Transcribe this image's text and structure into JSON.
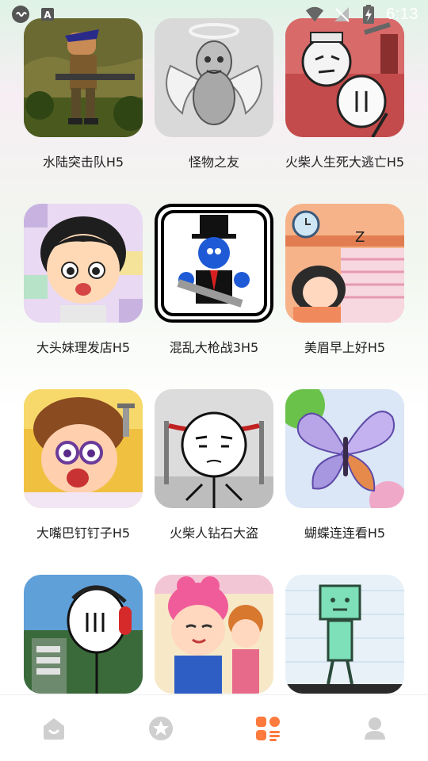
{
  "status_bar": {
    "time": "6:13",
    "icons": [
      "cast-icon",
      "a-notification-icon",
      "wifi-icon",
      "signal-off-icon",
      "battery-charging-icon"
    ]
  },
  "games": [
    {
      "title": "水陆突击队H5",
      "icon": "commando-soldier-art"
    },
    {
      "title": "怪物之友",
      "icon": "angel-monster-art"
    },
    {
      "title": "火柴人生死大逃亡H5",
      "icon": "stickman-escape-art"
    },
    {
      "title": "大头妹理发店H5",
      "icon": "bighead-girl-art"
    },
    {
      "title": "混乱大枪战3H5",
      "icon": "tophat-gunman-art"
    },
    {
      "title": "美眉早上好H5",
      "icon": "sleeping-girl-alarm-art"
    },
    {
      "title": "大嘴巴钉钉子H5",
      "icon": "bigmouth-nail-art"
    },
    {
      "title": "火柴人钻石大盗",
      "icon": "stickman-diamond-thief-art"
    },
    {
      "title": "蝴蝶连连看H5",
      "icon": "butterfly-art"
    },
    {
      "title": "",
      "icon": "stickman-headphones-art"
    },
    {
      "title": "",
      "icon": "cartoon-girls-art"
    },
    {
      "title": "",
      "icon": "green-doodle-man-art"
    }
  ],
  "bottom_nav": {
    "items": [
      {
        "icon": "home-icon",
        "active": false
      },
      {
        "icon": "star-badge-icon",
        "active": false
      },
      {
        "icon": "category-grid-icon",
        "active": true
      },
      {
        "icon": "profile-icon",
        "active": false
      }
    ],
    "active_color": "#ff7a3d",
    "inactive_color": "#cfcfcf"
  }
}
